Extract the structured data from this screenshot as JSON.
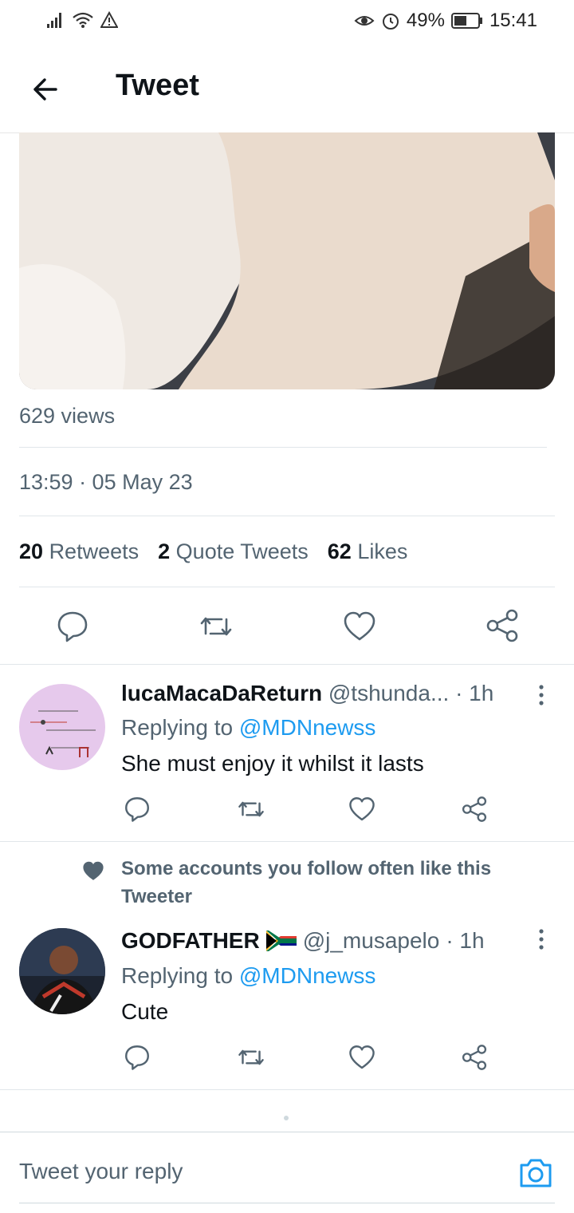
{
  "status_bar": {
    "battery": "49%",
    "time": "15:41"
  },
  "header": {
    "title": "Tweet"
  },
  "tweet": {
    "views": "629 views",
    "timestamp": "13:59 · 05 May 23",
    "stats": {
      "retweets_count": "20",
      "retweets_label": "Retweets",
      "quotes_count": "2",
      "quotes_label": "Quote Tweets",
      "likes_count": "62",
      "likes_label": "Likes"
    }
  },
  "replies": [
    {
      "name": "lucaMacaDaReturn",
      "handle": "@tshunda...",
      "time": "· 1h",
      "replying_prefix": "Replying to ",
      "replying_to": "@MDNnewss",
      "text": "She must enjoy it whilst it lasts"
    },
    {
      "social_context": "Some accounts you follow often like this Tweeter",
      "name": "GODFATHER",
      "handle": "@j_musapelo",
      "time": "· 1h",
      "replying_prefix": "Replying to ",
      "replying_to": "@MDNnewss",
      "text": "Cute"
    }
  ],
  "reply_input": {
    "placeholder": "Tweet your reply"
  },
  "colors": {
    "accent": "#1d9bf0",
    "text": "#0f1419",
    "muted": "#536471"
  },
  "icons": [
    "signal-icon",
    "wifi-icon",
    "warning-icon",
    "eye-icon",
    "alarm-icon",
    "battery-icon",
    "back-arrow-icon",
    "reply-icon",
    "retweet-icon",
    "like-icon",
    "share-icon",
    "more-icon",
    "heart-icon",
    "camera-icon"
  ]
}
